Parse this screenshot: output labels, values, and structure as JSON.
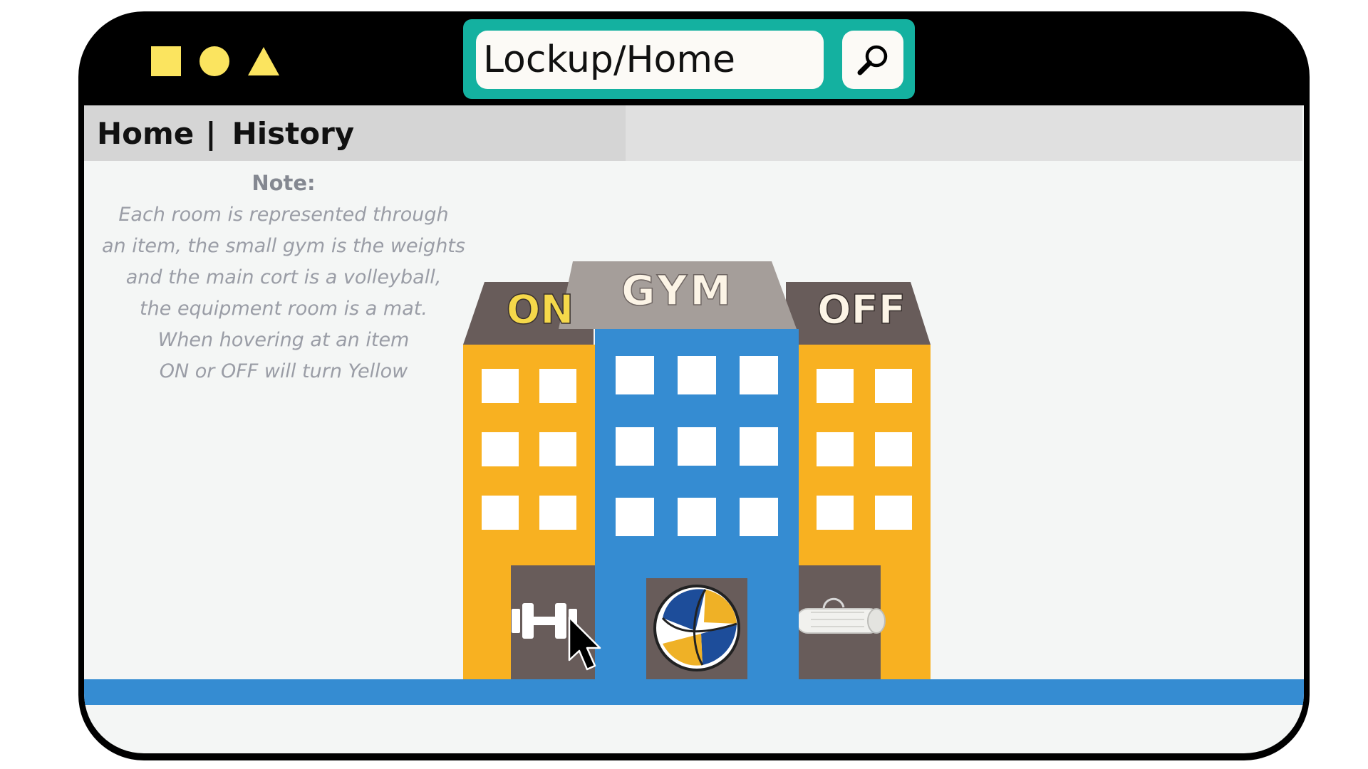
{
  "window": {
    "controls": [
      "square-shape",
      "circle-shape",
      "triangle-shape"
    ],
    "address_bar": {
      "value": "Lockup/Home"
    },
    "search_icon": "magnifier-icon"
  },
  "nav": {
    "home_label": "Home",
    "separator": "|",
    "history_label": "History"
  },
  "note": {
    "title": "Note:",
    "lines": [
      "Each room is represented through",
      "an item, the small gym is the weights",
      "and the main cort is a volleyball,",
      "the equipment room is a mat.",
      "When hovering at an item",
      "ON or OFF will turn Yellow"
    ]
  },
  "building": {
    "center_sign": "GYM",
    "left_sign": "ON",
    "right_sign": "OFF",
    "left_item": "dumbbell-icon",
    "center_item": "volleyball-icon",
    "right_item": "mat-icon"
  },
  "colors": {
    "frame": "#000000",
    "toolbar_shapes": "#fbe45f",
    "address_frame": "#14b1a0",
    "side_wing": "#f8b121",
    "center_tower": "#358cd2",
    "roof_side": "#685c5a",
    "roof_center": "#a59e9a",
    "sign_on_active": "#f5d84a",
    "sign_off": "#fcf4e6",
    "ground": "#358cd2"
  }
}
